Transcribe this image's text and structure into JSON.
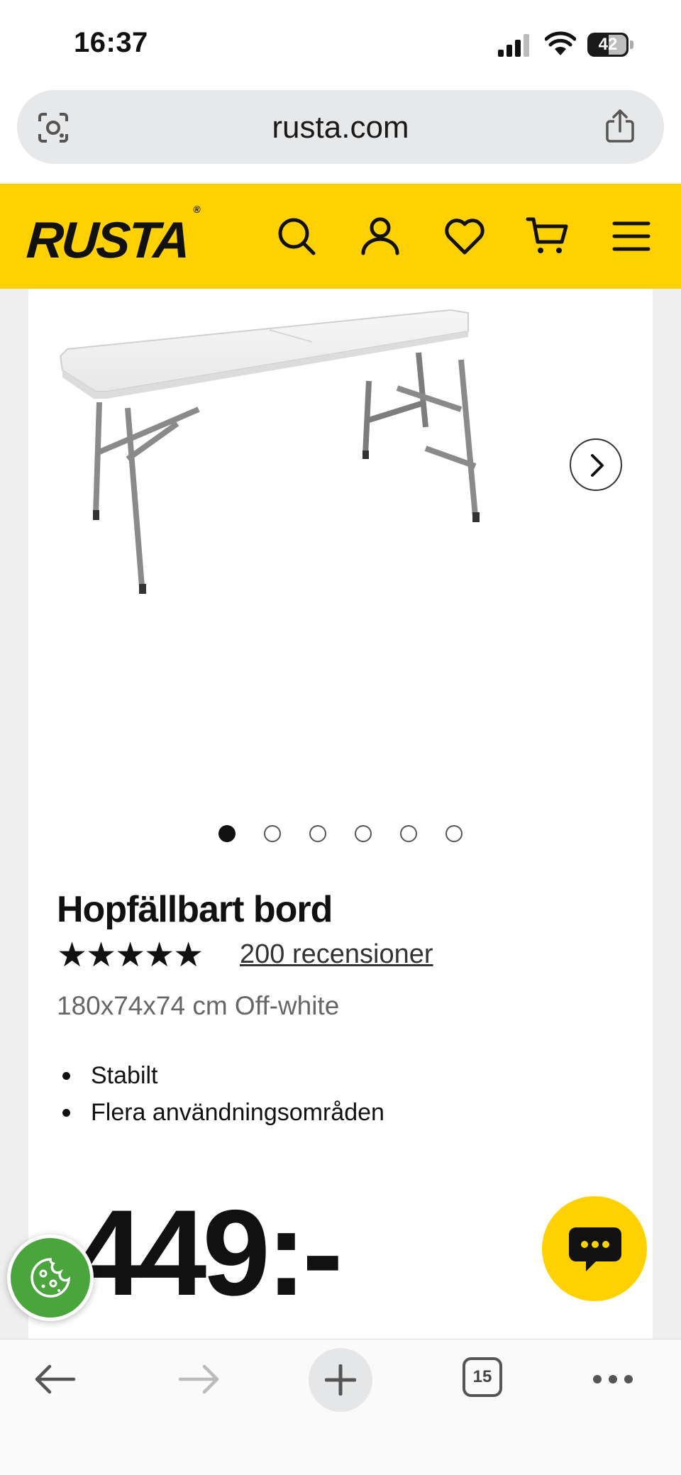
{
  "status_bar": {
    "time": "16:37",
    "battery": "42"
  },
  "browser": {
    "url": "rusta.com",
    "open_tabs": "15"
  },
  "site": {
    "brand": "RUSTA",
    "brand_mark": "®",
    "brand_color": "#ffd100"
  },
  "header_icons": [
    "search-icon",
    "account-icon",
    "heart-icon",
    "cart-icon",
    "menu-icon"
  ],
  "gallery": {
    "image_count": 6,
    "active_index": 0
  },
  "product": {
    "name": "Hopfällbart bord",
    "stars": "★★★★★",
    "rating": 5,
    "reviews": "200 recensioner",
    "variant": "180x74x74 cm Off-white",
    "features": [
      "Stabilt",
      "Flera användningsområden"
    ],
    "price": "449:-"
  }
}
